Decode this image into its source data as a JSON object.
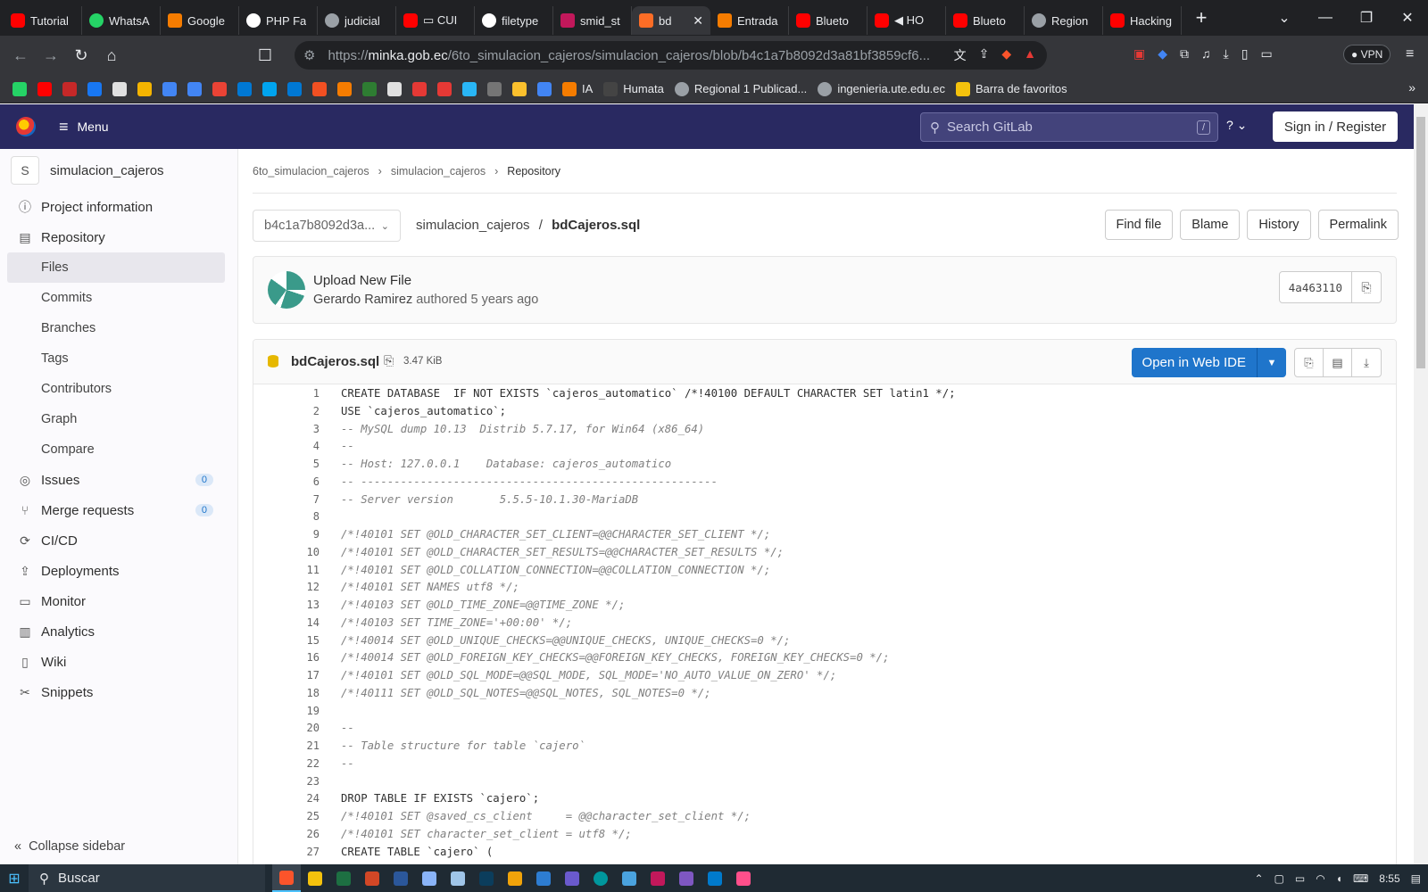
{
  "browser": {
    "tabs": [
      {
        "label": "Tutorial",
        "icon": "youtube",
        "icon_class": "yt"
      },
      {
        "label": "WhatsA",
        "icon": "whatsapp",
        "icon_class": "wa"
      },
      {
        "label": "Google",
        "icon": "google-slides",
        "icon_class": "bl"
      },
      {
        "label": "PHP Fa",
        "icon": "google",
        "icon_class": "go"
      },
      {
        "label": "judicial",
        "icon": "globe",
        "icon_class": "gy"
      },
      {
        "label": "▭ CUI",
        "icon": "youtube",
        "icon_class": "yt"
      },
      {
        "label": "filetype",
        "icon": "google",
        "icon_class": "go"
      },
      {
        "label": "smid_st",
        "icon": "bug",
        "icon_class": "rd"
      },
      {
        "label": "bd",
        "icon": "gitlab",
        "icon_class": "gl",
        "active": true
      },
      {
        "label": "Entrada",
        "icon": "blogger",
        "icon_class": "bl"
      },
      {
        "label": "Blueto",
        "icon": "youtube",
        "icon_class": "yt"
      },
      {
        "label": "◀ HO",
        "icon": "youtube",
        "icon_class": "yt"
      },
      {
        "label": "Blueto",
        "icon": "youtube",
        "icon_class": "yt"
      },
      {
        "label": "Region",
        "icon": "globe",
        "icon_class": "gy"
      },
      {
        "label": "Hacking",
        "icon": "youtube",
        "icon_class": "yt"
      }
    ],
    "url_scheme": "https://",
    "url_host": "minka.gob.ec",
    "url_path": "/6to_simulacion_cajeros/simulacion_cajeros/blob/b4c1a7b8092d3a81bf3859cf6...",
    "vpn_label": "VPN",
    "bookmarks": [
      {
        "label": "IA",
        "icon": "blogger"
      },
      {
        "label": "Humata",
        "icon": "humata"
      },
      {
        "label": "Regional 1 Publicad...",
        "icon": "globe"
      },
      {
        "label": "ingenieria.ute.edu.ec",
        "icon": "globe"
      },
      {
        "label": "Barra de favoritos",
        "icon": "folder"
      }
    ]
  },
  "gitlab": {
    "menu_label": "Menu",
    "search_placeholder": "Search GitLab",
    "search_shortcut": "/",
    "signin_label": "Sign in / Register"
  },
  "sidebar": {
    "project_initial": "S",
    "project_name": "simulacion_cajeros",
    "items": [
      {
        "label": "Project information",
        "icon": "info"
      },
      {
        "label": "Repository",
        "icon": "book"
      },
      {
        "label": "Files"
      },
      {
        "label": "Commits"
      },
      {
        "label": "Branches"
      },
      {
        "label": "Tags"
      },
      {
        "label": "Contributors"
      },
      {
        "label": "Graph"
      },
      {
        "label": "Compare"
      },
      {
        "label": "Issues",
        "badge": "0"
      },
      {
        "label": "Merge requests",
        "badge": "0"
      },
      {
        "label": "CI/CD"
      },
      {
        "label": "Deployments"
      },
      {
        "label": "Monitor"
      },
      {
        "label": "Analytics"
      },
      {
        "label": "Wiki"
      },
      {
        "label": "Snippets"
      }
    ],
    "collapse_label": "Collapse sidebar"
  },
  "main": {
    "breadcrumb": [
      "6to_simulacion_cajeros",
      "simulacion_cajeros",
      "Repository"
    ],
    "ref": "b4c1a7b8092d3a...",
    "path_dir": "simulacion_cajeros",
    "path_sep": "/",
    "path_file": "bdCajeros.sql",
    "buttons": [
      "Find file",
      "Blame",
      "History",
      "Permalink"
    ],
    "commit": {
      "title": "Upload New File",
      "author": "Gerardo Ramirez",
      "meta": "authored 5 years ago",
      "sha": "4a463110"
    },
    "file": {
      "name": "bdCajeros.sql",
      "size": "3.47 KiB",
      "web_ide": "Open in Web IDE"
    }
  },
  "code_lines": [
    {
      "n": "1",
      "t": "CREATE DATABASE  IF NOT EXISTS `cajeros_automatico` /*!40100 DEFAULT CHARACTER SET latin1 */;",
      "c": false
    },
    {
      "n": "2",
      "t": "USE `cajeros_automatico`;",
      "c": false
    },
    {
      "n": "3",
      "t": "-- MySQL dump 10.13  Distrib 5.7.17, for Win64 (x86_64)",
      "c": true
    },
    {
      "n": "4",
      "t": "--",
      "c": true
    },
    {
      "n": "5",
      "t": "-- Host: 127.0.0.1    Database: cajeros_automatico",
      "c": true
    },
    {
      "n": "6",
      "t": "-- ------------------------------------------------------",
      "c": true
    },
    {
      "n": "7",
      "t": "-- Server version\t5.5.5-10.1.30-MariaDB",
      "c": true
    },
    {
      "n": "8",
      "t": "",
      "c": false
    },
    {
      "n": "9",
      "t": "/*!40101 SET @OLD_CHARACTER_SET_CLIENT=@@CHARACTER_SET_CLIENT */;",
      "c": true
    },
    {
      "n": "10",
      "t": "/*!40101 SET @OLD_CHARACTER_SET_RESULTS=@@CHARACTER_SET_RESULTS */;",
      "c": true
    },
    {
      "n": "11",
      "t": "/*!40101 SET @OLD_COLLATION_CONNECTION=@@COLLATION_CONNECTION */;",
      "c": true
    },
    {
      "n": "12",
      "t": "/*!40101 SET NAMES utf8 */;",
      "c": true
    },
    {
      "n": "13",
      "t": "/*!40103 SET @OLD_TIME_ZONE=@@TIME_ZONE */;",
      "c": true
    },
    {
      "n": "14",
      "t": "/*!40103 SET TIME_ZONE='+00:00' */;",
      "c": true
    },
    {
      "n": "15",
      "t": "/*!40014 SET @OLD_UNIQUE_CHECKS=@@UNIQUE_CHECKS, UNIQUE_CHECKS=0 */;",
      "c": true
    },
    {
      "n": "16",
      "t": "/*!40014 SET @OLD_FOREIGN_KEY_CHECKS=@@FOREIGN_KEY_CHECKS, FOREIGN_KEY_CHECKS=0 */;",
      "c": true
    },
    {
      "n": "17",
      "t": "/*!40101 SET @OLD_SQL_MODE=@@SQL_MODE, SQL_MODE='NO_AUTO_VALUE_ON_ZERO' */;",
      "c": true
    },
    {
      "n": "18",
      "t": "/*!40111 SET @OLD_SQL_NOTES=@@SQL_NOTES, SQL_NOTES=0 */;",
      "c": true
    },
    {
      "n": "19",
      "t": "",
      "c": false
    },
    {
      "n": "20",
      "t": "--",
      "c": true
    },
    {
      "n": "21",
      "t": "-- Table structure for table `cajero`",
      "c": true
    },
    {
      "n": "22",
      "t": "--",
      "c": true
    },
    {
      "n": "23",
      "t": "",
      "c": false
    },
    {
      "n": "24",
      "t": "DROP TABLE IF EXISTS `cajero`;",
      "c": false
    },
    {
      "n": "25",
      "t": "/*!40101 SET @saved_cs_client     = @@character_set_client */;",
      "c": true
    },
    {
      "n": "26",
      "t": "/*!40101 SET character_set_client = utf8 */;",
      "c": true
    },
    {
      "n": "27",
      "t": "CREATE TABLE `cajero` (",
      "c": false
    }
  ],
  "taskbar": {
    "search_placeholder": "Buscar",
    "time": "8:55"
  }
}
